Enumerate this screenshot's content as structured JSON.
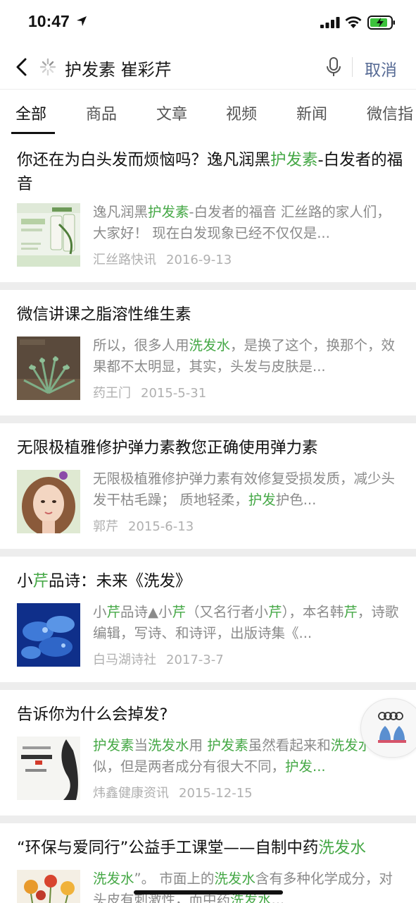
{
  "status": {
    "time": "10:47"
  },
  "search": {
    "query": "护发素 崔彩芹",
    "cancel_label": "取消"
  },
  "tabs": [
    {
      "label": "全部",
      "active": true
    },
    {
      "label": "商品"
    },
    {
      "label": "文章"
    },
    {
      "label": "视频"
    },
    {
      "label": "新闻"
    },
    {
      "label": "微信指"
    }
  ],
  "results": [
    {
      "title": [
        {
          "t": "你还在为白头发而烦恼吗？逸凡润黑"
        },
        {
          "t": "护发素",
          "hl": true
        },
        {
          "t": "-白发者的福音"
        }
      ],
      "snippet": [
        {
          "t": "逸凡润黑"
        },
        {
          "t": "护发素",
          "hl": true
        },
        {
          "t": "-白发者的福音 汇丝路的家人们，大家好！ 现在白发现象已经不仅仅是..."
        }
      ],
      "source": "汇丝路快讯",
      "date": "2016-9-13",
      "thumb": "product-bottles"
    },
    {
      "title": [
        {
          "t": "微信讲课之脂溶性维生素"
        }
      ],
      "snippet": [
        {
          "t": "所以，很多人用"
        },
        {
          "t": "洗发水",
          "hl": true
        },
        {
          "t": "，是换了这个，换那个，效果都不太明显，其实，头发与皮肤是..."
        }
      ],
      "source": "药王门",
      "date": "2015-5-31",
      "thumb": "plant"
    },
    {
      "title": [
        {
          "t": "无限极植雅修护弹力素教您正确使用弹力素"
        }
      ],
      "snippet": [
        {
          "t": "无限极植雅修护弹力素有效修复受损发质，减少头发干枯毛躁； 质地轻柔，"
        },
        {
          "t": "护发",
          "hl": true
        },
        {
          "t": "护色..."
        }
      ],
      "source": "郭芹",
      "date": "2015-6-13",
      "thumb": "portrait"
    },
    {
      "title": [
        {
          "t": "小"
        },
        {
          "t": "芹",
          "hl": true
        },
        {
          "t": "品诗：未来《洗发》"
        }
      ],
      "snippet": [
        {
          "t": "小"
        },
        {
          "t": "芹",
          "hl": true
        },
        {
          "t": "品诗▲小"
        },
        {
          "t": "芹",
          "hl": true
        },
        {
          "t": "（又名行者小"
        },
        {
          "t": "芹",
          "hl": true
        },
        {
          "t": "），本名韩"
        },
        {
          "t": "芹",
          "hl": true
        },
        {
          "t": "，诗歌编辑，写诗、和诗评，出版诗集《..."
        }
      ],
      "source": "白马湖诗社",
      "date": "2017-3-7",
      "thumb": "blue-flower"
    },
    {
      "title": [
        {
          "t": "告诉你为什么会掉发?"
        }
      ],
      "snippet": [
        {
          "t": "护发素",
          "hl": true
        },
        {
          "t": "当"
        },
        {
          "t": "洗发水",
          "hl": true
        },
        {
          "t": "用 "
        },
        {
          "t": "护发素",
          "hl": true
        },
        {
          "t": "虽然看起来和"
        },
        {
          "t": "洗发水",
          "hl": true
        },
        {
          "t": "很相似，但是两者成分有很大不同，"
        },
        {
          "t": "护发...",
          "hl": true
        }
      ],
      "source": "炜鑫健康资讯",
      "date": "2015-12-15",
      "thumb": "hair-poster"
    },
    {
      "title": [
        {
          "t": "“环保与爱同行”公益手工课堂——自制中药"
        },
        {
          "t": "洗发水",
          "hl": true
        }
      ],
      "snippet": [
        {
          "t": "洗发水",
          "hl": true
        },
        {
          "t": "”。 市面上的"
        },
        {
          "t": "洗发水",
          "hl": true
        },
        {
          "t": "含有多种化学成分，对头皮有刺激性，而中药"
        },
        {
          "t": "洗发水",
          "hl": true
        },
        {
          "t": "..."
        }
      ],
      "source": "",
      "date": "",
      "thumb": "flowers"
    }
  ]
}
